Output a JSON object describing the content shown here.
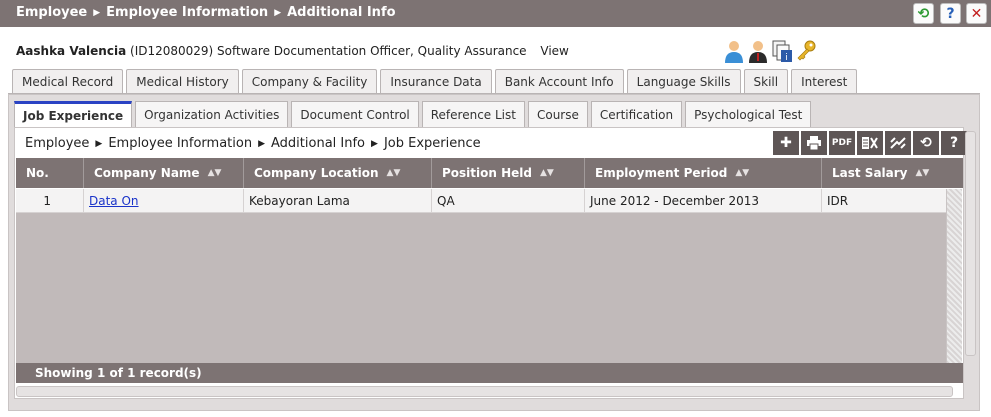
{
  "title_bar": {
    "crumbs": [
      "Employee",
      "Employee Information",
      "Additional Info"
    ]
  },
  "employee": {
    "name": "Aashka Valencia",
    "details": "(ID12080029) Software Documentation Officer, Quality Assurance",
    "view_link": "View"
  },
  "tabs_row1": [
    "Medical Record",
    "Medical History",
    "Company & Facility",
    "Insurance Data",
    "Bank Account Info",
    "Language Skills",
    "Skill",
    "Interest"
  ],
  "tabs_row2": [
    "Job Experience",
    "Organization Activities",
    "Document Control",
    "Reference List",
    "Course",
    "Certification",
    "Psychological Test"
  ],
  "active_tab": "Job Experience",
  "breadcrumb": [
    "Employee",
    "Employee Information",
    "Additional Info",
    "Job Experience"
  ],
  "toolbar": {
    "pdf_label": "PDF",
    "help_label": "?"
  },
  "table": {
    "headers": [
      "No.",
      "Company Name",
      "Company Location",
      "Position Held",
      "Employment Period",
      "Last Salary"
    ],
    "sort_glyph": "▲▼",
    "rows": [
      [
        "1",
        "Data On",
        "Kebayoran Lama",
        "QA",
        "June 2012 - December 2013",
        "IDR"
      ]
    ],
    "footer": "Showing 1 of 1 record(s)"
  }
}
